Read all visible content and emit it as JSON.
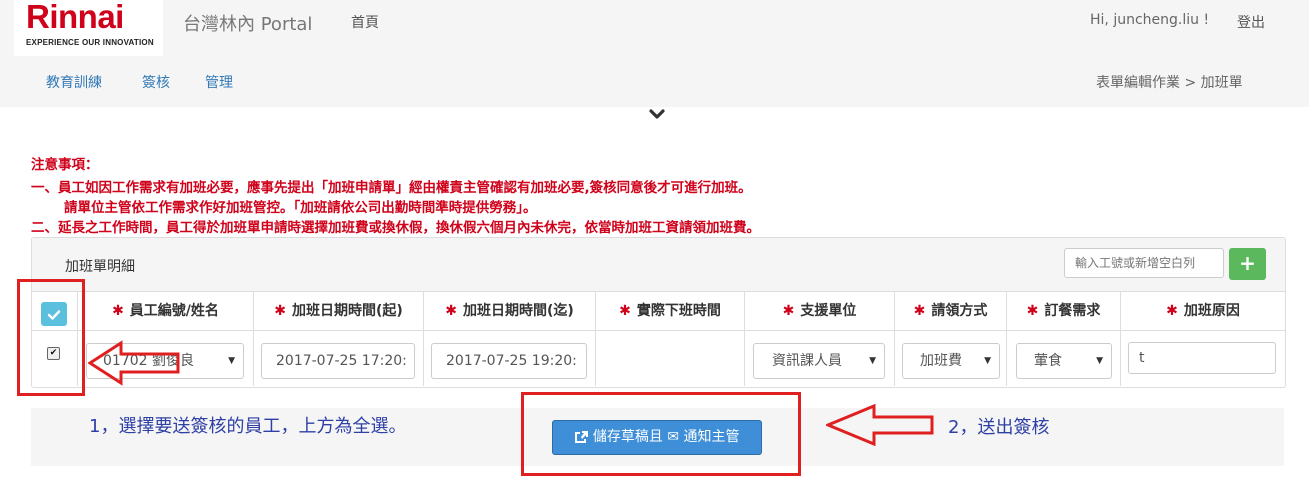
{
  "header": {
    "logo_text": "Rinnai",
    "logo_tagline": "EXPERIENCE OUR INNOVATION",
    "portal_title": "台灣林內 Portal",
    "home_link": "首頁",
    "greeting": "Hi, juncheng.liu !",
    "logout": "登出"
  },
  "menu": {
    "items": [
      "教育訓練",
      "簽核",
      "管理"
    ],
    "breadcrumb": "表單編輯作業 > 加班單"
  },
  "notice": {
    "title": "注意事項：",
    "line1": "一、員工如因工作需求有加班必要，應事先提出「加班申請單」經由權責主管確認有加班必要,簽核同意後才可進行加班。",
    "line2": "請單位主管依工作需求作好加班管控。「加班請依公司出勤時間準時提供勞務」。",
    "line3": "二、延長之工作時間，員工得於加班單申請時選擇加班費或換休假，換休假六個月內未休完，依當時加班工資請領加班費。"
  },
  "panel": {
    "title": "加班單明細",
    "employee_input_placeholder": "輸入工號或新增空白列",
    "add_button": "+"
  },
  "table": {
    "columns": [
      "員工編號/姓名",
      "加班日期時間(起)",
      "加班日期時間(迄)",
      "實際下班時間",
      "支援單位",
      "請領方式",
      "訂餐需求",
      "加班原因"
    ],
    "row": {
      "employee": "01702 劉俊良",
      "start": "2017-07-25 17:20:",
      "end": "2017-07-25 19:20:",
      "actual_off": "",
      "unit": "資訊課人員",
      "claim": "加班費",
      "meal": "葷食",
      "reason": "t"
    }
  },
  "annotations": {
    "hint1": "1，選擇要送簽核的員工，上方為全選。",
    "hint2": "2，送出簽核"
  },
  "footer": {
    "submit_label": "儲存草稿且 ✉ 通知主管"
  },
  "colors": {
    "brand_red": "#d0021b",
    "link_blue": "#337ab7",
    "info_blue": "#5bc0de",
    "success_green": "#5cb85c",
    "primary_blue": "#3e8fd8",
    "annotation_red": "#e02020",
    "hint_blue": "#2e3fa6"
  }
}
